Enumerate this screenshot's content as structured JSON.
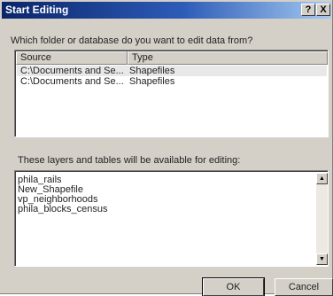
{
  "window": {
    "title": "Start Editing",
    "help_button": "?",
    "close_button": "X"
  },
  "prompt": "Which folder or database do you want to edit data from?",
  "sources_list": {
    "columns": [
      "Source",
      "Type"
    ],
    "rows": [
      {
        "source": "C:\\Documents and Se...",
        "type": "Shapefiles",
        "selected": true
      },
      {
        "source": "C:\\Documents and Se...",
        "type": "Shapefiles",
        "selected": false
      }
    ]
  },
  "layers_label": "These layers and tables will be available for editing:",
  "layers": [
    "phila_rails",
    "New_Shapefile",
    "vp_neighborhoods",
    "phila_blocks_census"
  ],
  "scroll_icons": {
    "up": "scroll-up-arrow",
    "down": "scroll-down-arrow"
  },
  "buttons": {
    "ok": "OK",
    "cancel": "Cancel"
  }
}
